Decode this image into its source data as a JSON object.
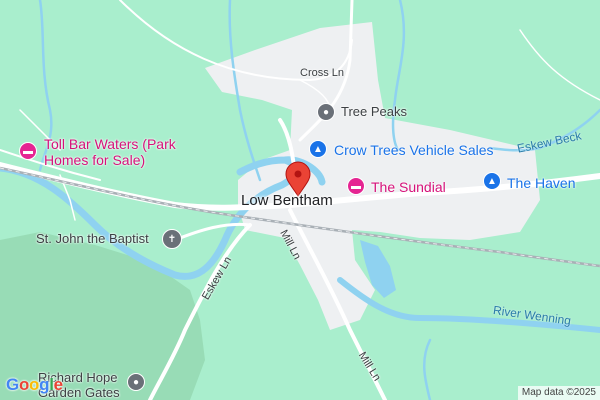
{
  "map": {
    "road_labels": {
      "cross_ln": "Cross Ln",
      "mill_ln_north": "Mill Ln",
      "mill_ln_south": "Mill Ln",
      "eskew_ln": "Eskew Ln"
    },
    "place_label": "Low Bentham",
    "pois": {
      "tree_peaks": "Tree Peaks",
      "crow_trees": "Crow Trees Vehicle Sales",
      "the_sundial": "The Sundial",
      "the_haven": "The Haven",
      "toll_bar_line1": "Toll Bar Waters (Park",
      "toll_bar_line2": "Homes for Sale)",
      "st_john": "St. John the Baptist",
      "richard_hope_line1": "Richard Hope",
      "richard_hope_line2": "Garden Gates"
    },
    "water_labels": {
      "river_wenning": "River Wenning",
      "eskew_beck": "Eskew Beck"
    },
    "attribution": "Map data ©2025",
    "logo": {
      "text": "Google",
      "colors": [
        "#4285F4",
        "#EA4335",
        "#FBBC05",
        "#4285F4",
        "#34A853",
        "#EA4335"
      ]
    },
    "colors": {
      "land": "#a9eecd",
      "urban": "#eef0f2",
      "water": "#8fd2f0",
      "pin": "#ea4335"
    }
  }
}
